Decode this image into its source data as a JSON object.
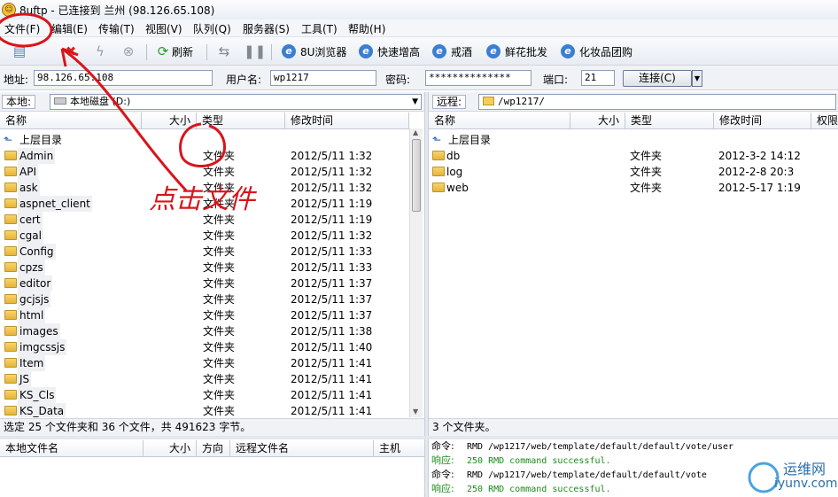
{
  "window": {
    "title": "8uftp - 已连接到 兰州 (98.126.65.108)"
  },
  "menu": [
    "文件(F)",
    "编辑(E)",
    "传输(T)",
    "视图(V)",
    "队列(Q)",
    "服务器(S)",
    "工具(T)",
    "帮助(H)"
  ],
  "toolbar": {
    "refresh": "刷新",
    "links": [
      "8U浏览器",
      "快速增高",
      "戒酒",
      "鲜花批发",
      "化妆品团购"
    ]
  },
  "connection": {
    "address_label": "地址:",
    "address_value": "98.126.65.108",
    "username_label": "用户名:",
    "username_value": "wp1217",
    "password_label": "密码:",
    "password_value": "**************",
    "port_label": "端口:",
    "port_value": "21",
    "connect_label": "连接(C)"
  },
  "local": {
    "label": "本地:",
    "path": "本地磁盘 (D:)",
    "columns": [
      "名称",
      "大小",
      "类型",
      "修改时间"
    ],
    "parent": "上层目录",
    "rows": [
      {
        "name": "Admin",
        "type": "文件夹",
        "date": "2012/5/11 1:32"
      },
      {
        "name": "API",
        "type": "文件夹",
        "date": "2012/5/11 1:32"
      },
      {
        "name": "ask",
        "type": "文件夹",
        "date": "2012/5/11 1:32"
      },
      {
        "name": "aspnet_client",
        "type": "文件夹",
        "date": "2012/5/11 1:19"
      },
      {
        "name": "cert",
        "type": "文件夹",
        "date": "2012/5/11 1:19"
      },
      {
        "name": "cgal",
        "type": "文件夹",
        "date": "2012/5/11 1:32"
      },
      {
        "name": "Config",
        "type": "文件夹",
        "date": "2012/5/11 1:33"
      },
      {
        "name": "cpzs",
        "type": "文件夹",
        "date": "2012/5/11 1:33"
      },
      {
        "name": "editor",
        "type": "文件夹",
        "date": "2012/5/11 1:37"
      },
      {
        "name": "gcjsjs",
        "type": "文件夹",
        "date": "2012/5/11 1:37"
      },
      {
        "name": "html",
        "type": "文件夹",
        "date": "2012/5/11 1:37"
      },
      {
        "name": "images",
        "type": "文件夹",
        "date": "2012/5/11 1:38"
      },
      {
        "name": "imgcssjs",
        "type": "文件夹",
        "date": "2012/5/11 1:40"
      },
      {
        "name": "Item",
        "type": "文件夹",
        "date": "2012/5/11 1:41"
      },
      {
        "name": "JS",
        "type": "文件夹",
        "date": "2012/5/11 1:41"
      },
      {
        "name": "KS_Cls",
        "type": "文件夹",
        "date": "2012/5/11 1:41"
      },
      {
        "name": "KS_Data",
        "type": "文件夹",
        "date": "2012/5/11 1:41"
      }
    ],
    "status": "选定 25 个文件夹和 36 个文件，共 491623 字节。"
  },
  "remote": {
    "label": "远程:",
    "path": "/wp1217/",
    "columns": [
      "名称",
      "大小",
      "类型",
      "修改时间",
      "权限"
    ],
    "parent": "上层目录",
    "rows": [
      {
        "name": "db",
        "type": "文件夹",
        "date": "2012-3-2 14:12"
      },
      {
        "name": "log",
        "type": "文件夹",
        "date": "2012-2-8 20:3"
      },
      {
        "name": "web",
        "type": "文件夹",
        "date": "2012-5-17 1:19"
      }
    ],
    "status": "3 个文件夹。"
  },
  "queue": {
    "columns": [
      "本地文件名",
      "大小",
      "方向",
      "远程文件名",
      "主机"
    ]
  },
  "log": [
    {
      "prefix": "命令:",
      "text": "RMD /wp1217/web/template/default/default/vote/user",
      "color": "#000000"
    },
    {
      "prefix": "响应:",
      "text": "250 RMD command successful.",
      "color": "#1a8a1a"
    },
    {
      "prefix": "命令:",
      "text": "RMD /wp1217/web/template/default/default/vote",
      "color": "#000000"
    },
    {
      "prefix": "响应:",
      "text": "250 RMD command successful.",
      "color": "#1a8a1a"
    }
  ],
  "annotation": "点击文件",
  "watermark": {
    "cn": "运维网",
    "url": "iyunv.com"
  }
}
